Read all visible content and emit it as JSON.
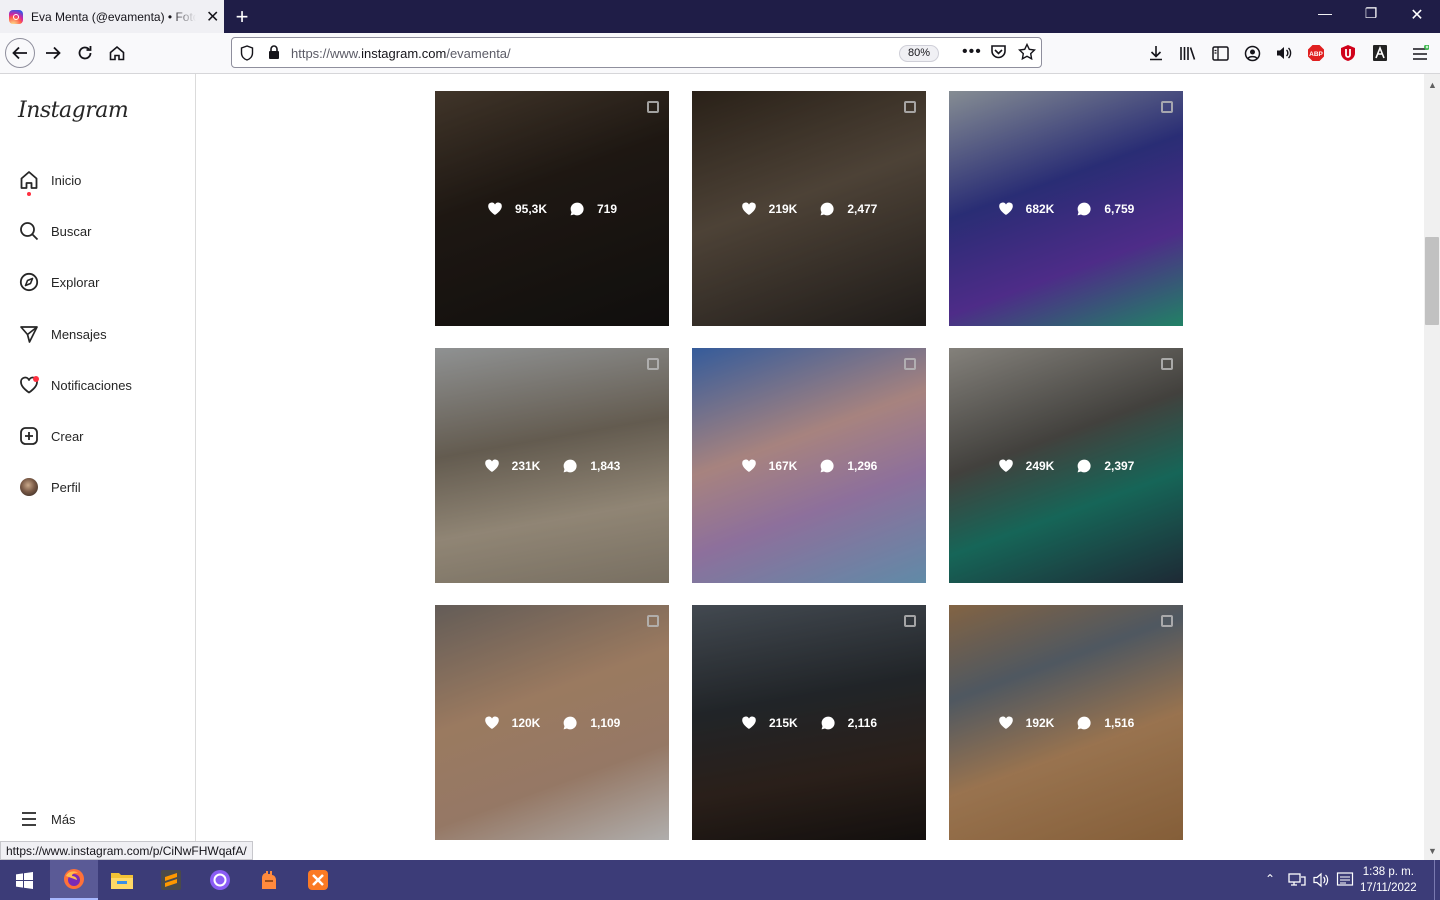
{
  "browser": {
    "tab_title": "Eva Menta (@evamenta) • Fotos",
    "url_prefix": "https://www.",
    "url_host": "instagram.com",
    "url_path": "/evamenta/",
    "zoom": "80%",
    "status_url": "https://www.instagram.com/p/CiNwFHWqafA/"
  },
  "sidebar": {
    "logo": "Instagram",
    "items": [
      {
        "label": "Inicio",
        "icon": "home-icon"
      },
      {
        "label": "Buscar",
        "icon": "search-icon"
      },
      {
        "label": "Explorar",
        "icon": "compass-icon"
      },
      {
        "label": "Mensajes",
        "icon": "paper-plane-icon"
      },
      {
        "label": "Notificaciones",
        "icon": "heart-icon"
      },
      {
        "label": "Crear",
        "icon": "plus-square-icon"
      },
      {
        "label": "Perfil",
        "icon": "avatar"
      }
    ],
    "more": "Más"
  },
  "posts": [
    {
      "likes": "95,3K",
      "comments": "719",
      "bg": "linear-gradient(160deg,#5a4a3a 0%,#2a211a 40%,#171513 100%)"
    },
    {
      "likes": "219K",
      "comments": "2,477",
      "bg": "linear-gradient(160deg,#3a2e22 0%,#6b5c4c 45%,#2b2623 100%)"
    },
    {
      "likes": "682K",
      "comments": "6,759",
      "bg": "linear-gradient(160deg,#b9c3cc 0%,#3a3fa2 40%,#6c3dbd 70%,#2fb48d 100%)"
    },
    {
      "likes": "231K",
      "comments": "1,843",
      "bg": "linear-gradient(170deg,#c7cacb 0%,#8a7f6f 40%,#c8b9a2 70%,#a79b88 100%)"
    },
    {
      "likes": "167K",
      "comments": "1,296",
      "bg": "linear-gradient(160deg,#4a7fd6 0%,#e8b6b0 40%,#c49bd8 65%,#86c0e8 100%)"
    },
    {
      "likes": "249K",
      "comments": "2,397",
      "bg": "linear-gradient(160deg,#b7b3ab 0%,#5c5a55 40%,#1f8d7a 65%,#2a3a4a 100%)"
    },
    {
      "likes": "120K",
      "comments": "1,109",
      "bg": "linear-gradient(160deg,#8a8079 0%,#d6a985 40%,#cfa78d 70%,#f4f1ef 100%)"
    },
    {
      "likes": "215K",
      "comments": "2,116",
      "bg": "linear-gradient(170deg,#5d6670 0%,#2e3338 40%,#3b2c24 70%,#1b1614 100%)"
    },
    {
      "likes": "192K",
      "comments": "1,516",
      "bg": "linear-gradient(160deg,#b58a5e 0%,#6e7a86 30%,#d4a06e 60%,#b8834f 100%)"
    }
  ],
  "taskbar": {
    "time": "1:38 p. m.",
    "date": "17/11/2022"
  }
}
